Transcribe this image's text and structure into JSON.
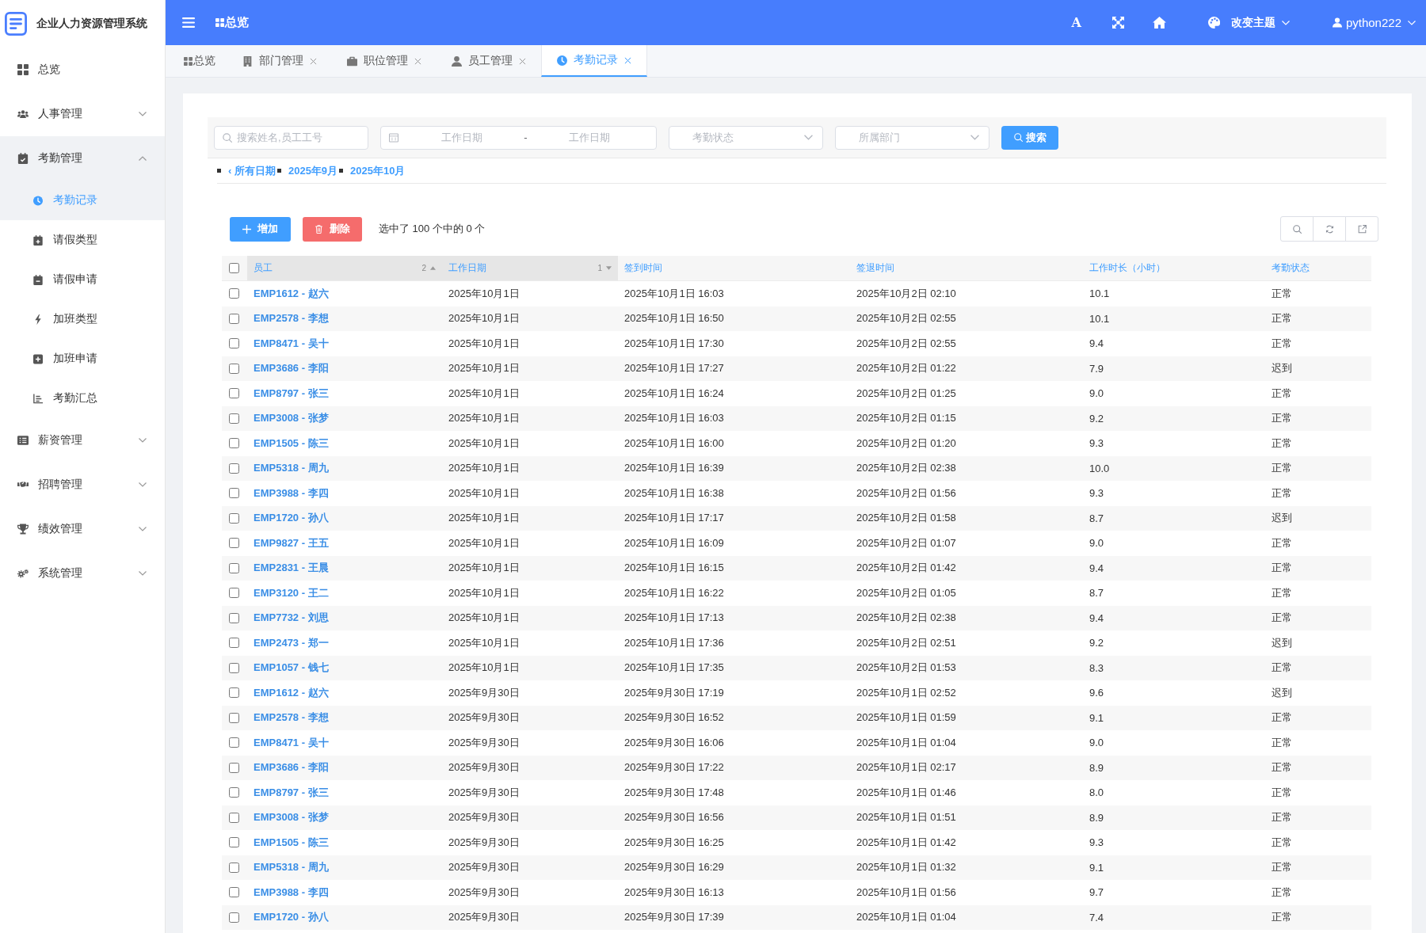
{
  "sidebar": {
    "title": "企业人力资源管理系统",
    "items": [
      {
        "label": "总览",
        "selected": false
      },
      {
        "label": "人事管理",
        "expanded": false
      },
      {
        "label": "考勤管理",
        "expanded": true,
        "children": [
          {
            "label": "考勤记录",
            "selected": true
          },
          {
            "label": "请假类型",
            "selected": false
          },
          {
            "label": "请假申请",
            "selected": false
          },
          {
            "label": "加班类型",
            "selected": false
          },
          {
            "label": "加班申请",
            "selected": false
          },
          {
            "label": "考勤汇总",
            "selected": false
          }
        ]
      },
      {
        "label": "薪资管理",
        "expanded": false
      },
      {
        "label": "招聘管理",
        "expanded": false
      },
      {
        "label": "绩效管理",
        "expanded": false
      },
      {
        "label": "系统管理",
        "expanded": false
      }
    ]
  },
  "header": {
    "breadcrumb": "总览",
    "font_button": "A",
    "theme_menu": "改变主题",
    "user_menu": "python222"
  },
  "tabs": [
    {
      "label": "总览",
      "closable": false,
      "selected": false
    },
    {
      "label": "部门管理",
      "closable": true,
      "selected": false
    },
    {
      "label": "职位管理",
      "closable": true,
      "selected": false
    },
    {
      "label": "员工管理",
      "closable": true,
      "selected": false
    },
    {
      "label": "考勤记录",
      "closable": true,
      "selected": true
    }
  ],
  "filters": {
    "search": {
      "placeholder": "搜索姓名,员工工号"
    },
    "date_range": {
      "start_placeholder": "工作日期",
      "separator": "-",
      "end_placeholder": "工作日期"
    },
    "status_select": {
      "placeholder": "考勤状态"
    },
    "department_select": {
      "placeholder": "所属部门"
    },
    "search_button": "搜索"
  },
  "date_hierarchy": [
    {
      "label": "‹ 所有日期"
    },
    {
      "label": "2025年9月"
    },
    {
      "label": "2025年10月"
    }
  ],
  "actions": {
    "add_button": "增加",
    "delete_button": "删除",
    "selection_count": "选中了 100 个中的 0 个"
  },
  "table": {
    "select_all": false,
    "columns": [
      {
        "label": "员工",
        "sort_priority": "2",
        "sort_ascending": true
      },
      {
        "label": "工作日期",
        "sort_priority": "1",
        "sort_ascending": false
      },
      {
        "label": "签到时间"
      },
      {
        "label": "签退时间"
      },
      {
        "label": "工作时长（小时）"
      },
      {
        "label": "考勤状态"
      }
    ],
    "rows": [
      {
        "selected": false,
        "cells": [
          "EMP1612 - 赵六",
          "2025年10月1日",
          "2025年10月1日 16:03",
          "2025年10月2日 02:10",
          "10.1",
          "正常"
        ]
      },
      {
        "selected": false,
        "cells": [
          "EMP2578 - 李想",
          "2025年10月1日",
          "2025年10月1日 16:50",
          "2025年10月2日 02:55",
          "10.1",
          "正常"
        ]
      },
      {
        "selected": false,
        "cells": [
          "EMP8471 - 吴十",
          "2025年10月1日",
          "2025年10月1日 17:30",
          "2025年10月2日 02:55",
          "9.4",
          "正常"
        ]
      },
      {
        "selected": false,
        "cells": [
          "EMP3686 - 李阳",
          "2025年10月1日",
          "2025年10月1日 17:27",
          "2025年10月2日 01:22",
          "7.9",
          "迟到"
        ]
      },
      {
        "selected": false,
        "cells": [
          "EMP8797 - 张三",
          "2025年10月1日",
          "2025年10月1日 16:24",
          "2025年10月2日 01:25",
          "9.0",
          "正常"
        ]
      },
      {
        "selected": false,
        "cells": [
          "EMP3008 - 张梦",
          "2025年10月1日",
          "2025年10月1日 16:03",
          "2025年10月2日 01:15",
          "9.2",
          "正常"
        ]
      },
      {
        "selected": false,
        "cells": [
          "EMP1505 - 陈三",
          "2025年10月1日",
          "2025年10月1日 16:00",
          "2025年10月2日 01:20",
          "9.3",
          "正常"
        ]
      },
      {
        "selected": false,
        "cells": [
          "EMP5318 - 周九",
          "2025年10月1日",
          "2025年10月1日 16:39",
          "2025年10月2日 02:38",
          "10.0",
          "正常"
        ]
      },
      {
        "selected": false,
        "cells": [
          "EMP3988 - 李四",
          "2025年10月1日",
          "2025年10月1日 16:38",
          "2025年10月2日 01:56",
          "9.3",
          "正常"
        ]
      },
      {
        "selected": false,
        "cells": [
          "EMP1720 - 孙八",
          "2025年10月1日",
          "2025年10月1日 17:17",
          "2025年10月2日 01:58",
          "8.7",
          "迟到"
        ]
      },
      {
        "selected": false,
        "cells": [
          "EMP9827 - 王五",
          "2025年10月1日",
          "2025年10月1日 16:09",
          "2025年10月2日 01:07",
          "9.0",
          "正常"
        ]
      },
      {
        "selected": false,
        "cells": [
          "EMP2831 - 王晨",
          "2025年10月1日",
          "2025年10月1日 16:15",
          "2025年10月2日 01:42",
          "9.4",
          "正常"
        ]
      },
      {
        "selected": false,
        "cells": [
          "EMP3120 - 王二",
          "2025年10月1日",
          "2025年10月1日 16:22",
          "2025年10月2日 01:05",
          "8.7",
          "正常"
        ]
      },
      {
        "selected": false,
        "cells": [
          "EMP7732 - 刘思",
          "2025年10月1日",
          "2025年10月1日 17:13",
          "2025年10月2日 02:38",
          "9.4",
          "正常"
        ]
      },
      {
        "selected": false,
        "cells": [
          "EMP2473 - 郑一",
          "2025年10月1日",
          "2025年10月1日 17:36",
          "2025年10月2日 02:51",
          "9.2",
          "迟到"
        ]
      },
      {
        "selected": false,
        "cells": [
          "EMP1057 - 钱七",
          "2025年10月1日",
          "2025年10月1日 17:35",
          "2025年10月2日 01:53",
          "8.3",
          "正常"
        ]
      },
      {
        "selected": false,
        "cells": [
          "EMP1612 - 赵六",
          "2025年9月30日",
          "2025年9月30日 17:19",
          "2025年10月1日 02:52",
          "9.6",
          "迟到"
        ]
      },
      {
        "selected": false,
        "cells": [
          "EMP2578 - 李想",
          "2025年9月30日",
          "2025年9月30日 16:52",
          "2025年10月1日 01:59",
          "9.1",
          "正常"
        ]
      },
      {
        "selected": false,
        "cells": [
          "EMP8471 - 吴十",
          "2025年9月30日",
          "2025年9月30日 16:06",
          "2025年10月1日 01:04",
          "9.0",
          "正常"
        ]
      },
      {
        "selected": false,
        "cells": [
          "EMP3686 - 李阳",
          "2025年9月30日",
          "2025年9月30日 17:22",
          "2025年10月1日 02:17",
          "8.9",
          "正常"
        ]
      },
      {
        "selected": false,
        "cells": [
          "EMP8797 - 张三",
          "2025年9月30日",
          "2025年9月30日 17:48",
          "2025年10月1日 01:46",
          "8.0",
          "正常"
        ]
      },
      {
        "selected": false,
        "cells": [
          "EMP3008 - 张梦",
          "2025年9月30日",
          "2025年9月30日 16:56",
          "2025年10月1日 01:51",
          "8.9",
          "正常"
        ]
      },
      {
        "selected": false,
        "cells": [
          "EMP1505 - 陈三",
          "2025年9月30日",
          "2025年9月30日 16:25",
          "2025年10月1日 01:42",
          "9.3",
          "正常"
        ]
      },
      {
        "selected": false,
        "cells": [
          "EMP5318 - 周九",
          "2025年9月30日",
          "2025年9月30日 16:29",
          "2025年10月1日 01:32",
          "9.1",
          "正常"
        ]
      },
      {
        "selected": false,
        "cells": [
          "EMP3988 - 李四",
          "2025年9月30日",
          "2025年9月30日 16:13",
          "2025年10月1日 01:56",
          "9.7",
          "正常"
        ]
      },
      {
        "selected": false,
        "cells": [
          "EMP1720 - 孙八",
          "2025年9月30日",
          "2025年9月30日 17:39",
          "2025年10月1日 01:04",
          "7.4",
          "正常"
        ]
      }
    ]
  }
}
